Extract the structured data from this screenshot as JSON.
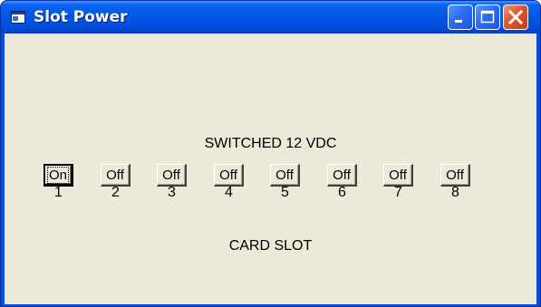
{
  "window": {
    "title": "Slot Power"
  },
  "content": {
    "heading": "SWITCHED 12 VDC",
    "footer": "CARD SLOT"
  },
  "slots": [
    {
      "number": "1",
      "label": "On",
      "focused": true
    },
    {
      "number": "2",
      "label": "Off"
    },
    {
      "number": "3",
      "label": "Off"
    },
    {
      "number": "4",
      "label": "Off"
    },
    {
      "number": "5",
      "label": "Off"
    },
    {
      "number": "6",
      "label": "Off"
    },
    {
      "number": "7",
      "label": "Off"
    },
    {
      "number": "8",
      "label": "Off"
    }
  ],
  "icons": {
    "app": "app-window-icon",
    "minimize": "minimize-icon",
    "maximize": "maximize-icon",
    "close": "close-icon"
  },
  "colors": {
    "titlebar": "#0058e6",
    "client_background": "#ece9d8",
    "close_button": "#e2532c"
  }
}
